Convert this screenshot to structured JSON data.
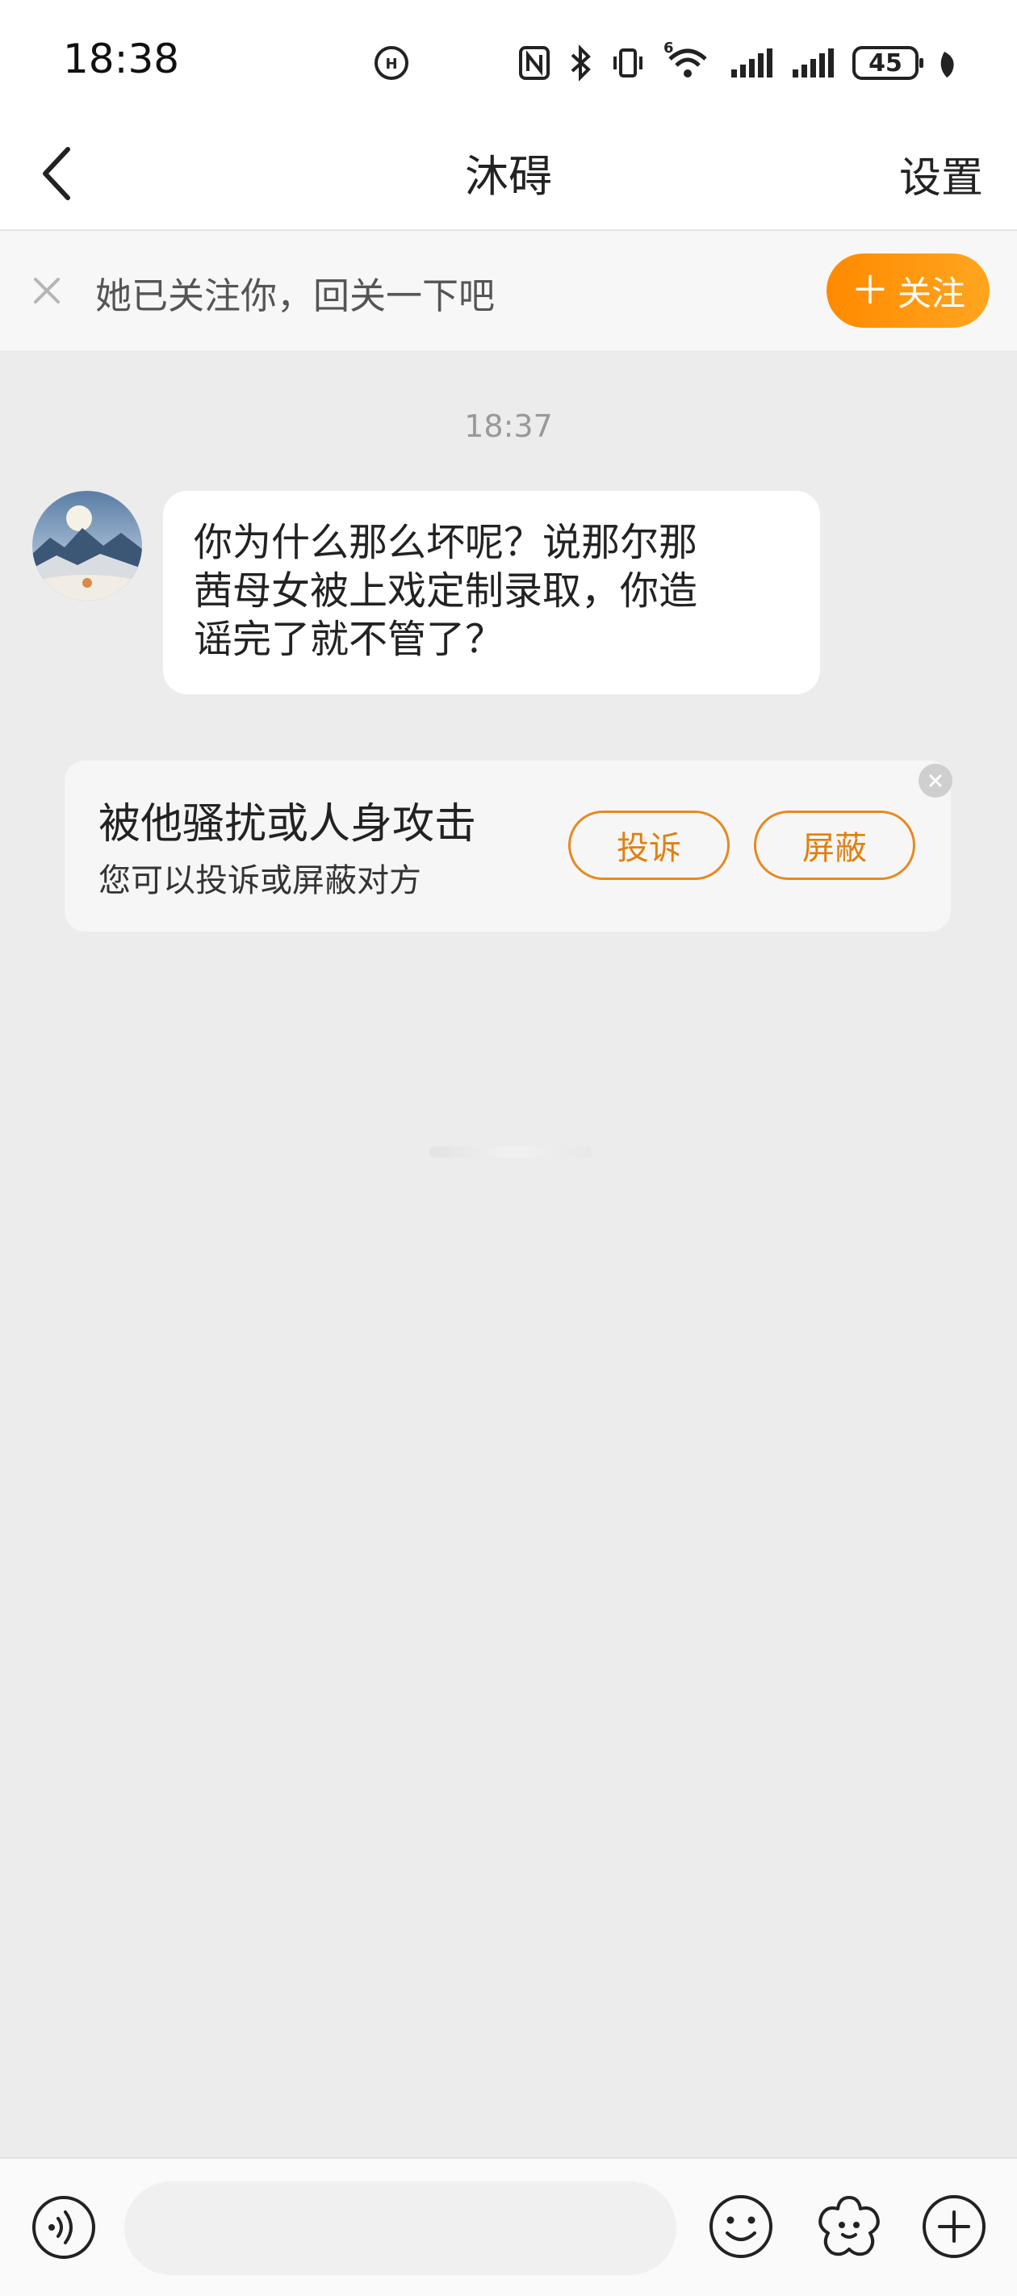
{
  "status_bar": {
    "time": "18:38",
    "battery_level": "45",
    "network_label": "6",
    "icons": [
      "hd-call-icon",
      "nfc-icon",
      "bluetooth-icon",
      "vibrate-icon",
      "wifi-icon",
      "signal-icon",
      "signal-icon",
      "battery-icon",
      "leaf-icon"
    ]
  },
  "nav": {
    "title": "沐碍",
    "settings_label": "设置"
  },
  "banner": {
    "text": "她已关注你，回关一下吧",
    "follow_label": "关注",
    "accent": "#ff9200"
  },
  "chat": {
    "timestamp": "18:37",
    "messages": [
      {
        "lines": [
          "你为什么那么坏呢？说那尔那",
          "茜母女被上戏定制录取，你造",
          "谣完了就不管了？"
        ]
      }
    ]
  },
  "harass_card": {
    "title": "被他骚扰或人身攻击",
    "subtitle": "您可以投诉或屏蔽对方",
    "report_label": "投诉",
    "block_label": "屏蔽",
    "accent": "#e58a1f"
  },
  "composer": {
    "placeholder": ""
  }
}
